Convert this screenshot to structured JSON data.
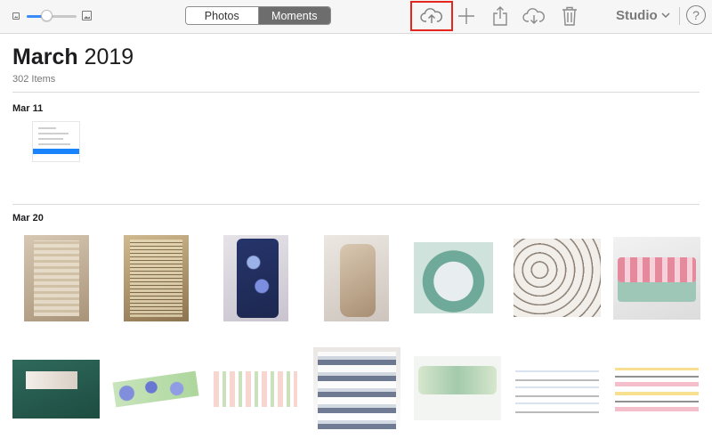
{
  "toolbar": {
    "segments": [
      "Photos",
      "Moments"
    ],
    "active_segment": "Moments",
    "studio_label": "Studio",
    "help_label": "?",
    "icons": [
      "photo-small-icon",
      "zoom-slider",
      "photo-large-icon",
      "upload-cloud-icon",
      "add-plus-icon",
      "share-icon",
      "download-cloud-icon",
      "trash-icon",
      "chevron-down-icon",
      "help-icon"
    ],
    "zoom_level": 0.4
  },
  "header": {
    "month": "March",
    "year": "2019",
    "count": "302 Items"
  },
  "groups": [
    {
      "date": "Mar 11"
    },
    {
      "date": "Mar 20"
    }
  ],
  "colors": {
    "highlight": "#e5261f",
    "segment_active": "#6d6d6d",
    "accent": "#3b8cf6"
  }
}
